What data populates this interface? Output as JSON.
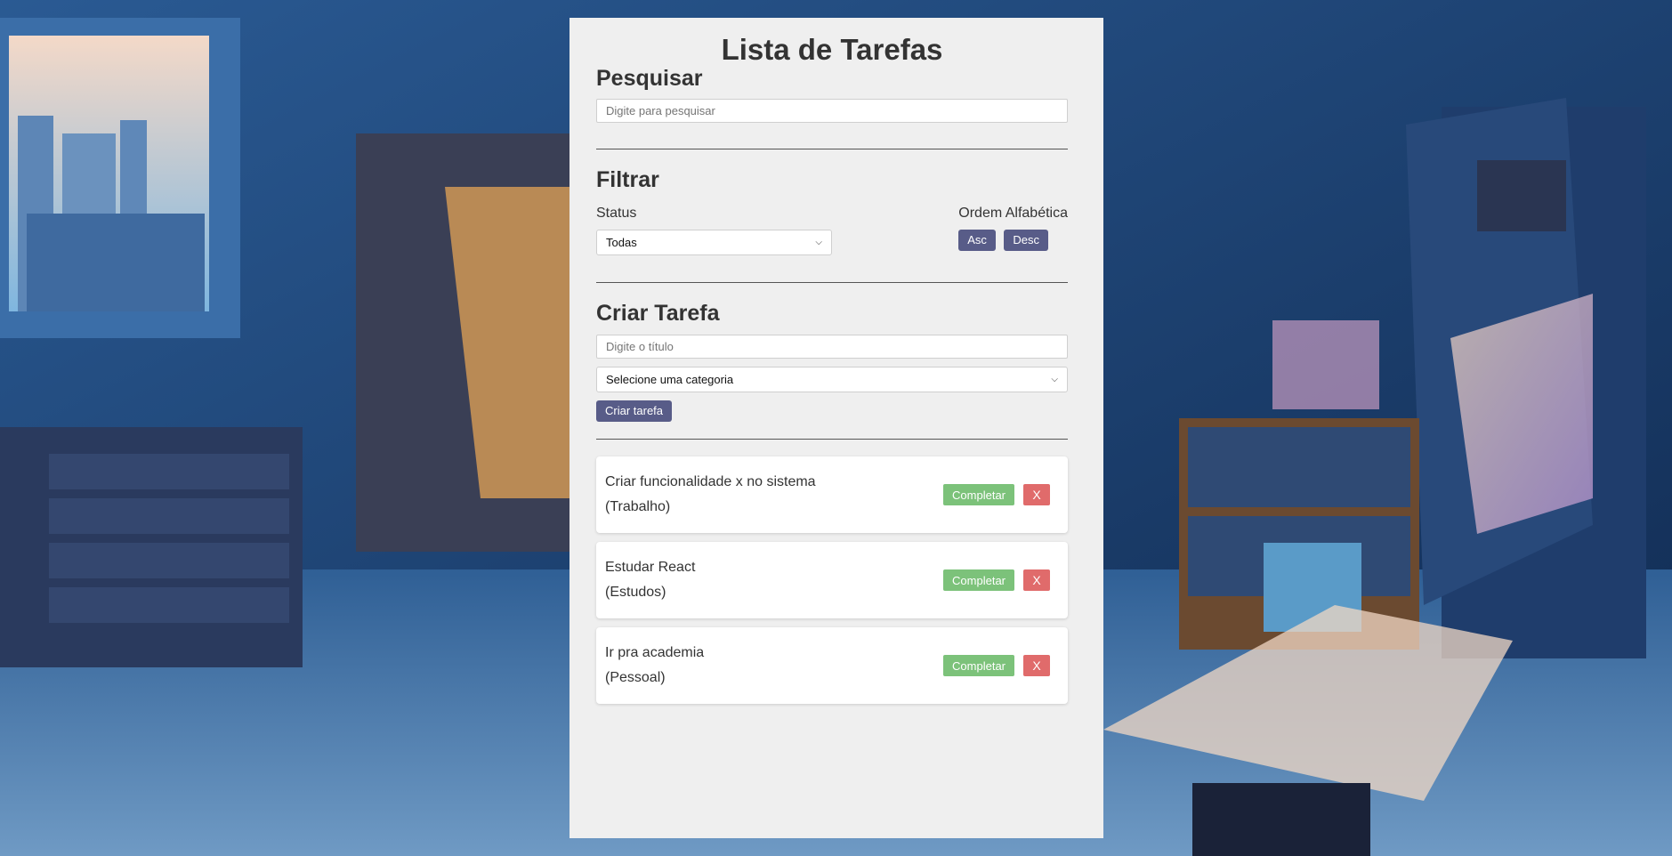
{
  "app": {
    "title": "Lista de Tarefas"
  },
  "search": {
    "heading": "Pesquisar",
    "placeholder": "Digite para pesquisar",
    "value": ""
  },
  "filter": {
    "heading": "Filtrar",
    "status_label": "Status",
    "status_selected": "Todas",
    "order_label": "Ordem Alfabética",
    "asc_label": "Asc",
    "desc_label": "Desc"
  },
  "create": {
    "heading": "Criar Tarefa",
    "title_placeholder": "Digite o título",
    "title_value": "",
    "category_selected": "Selecione uma categoria",
    "submit_label": "Criar tarefa"
  },
  "tasks": [
    {
      "text": "Criar funcionalidade x no sistema",
      "category": "(Trabalho)",
      "complete_label": "Completar",
      "delete_label": "X"
    },
    {
      "text": "Estudar React",
      "category": "(Estudos)",
      "complete_label": "Completar",
      "delete_label": "X"
    },
    {
      "text": "Ir pra academia",
      "category": "(Pessoal)",
      "complete_label": "Completar",
      "delete_label": "X"
    }
  ],
  "colors": {
    "panel_bg": "#efefef",
    "primary_button": "#585c88",
    "complete_button": "#7cc27a",
    "delete_button": "#e06b6b"
  }
}
